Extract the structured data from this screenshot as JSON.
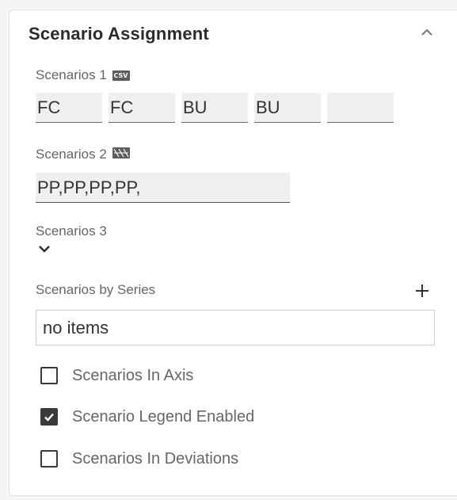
{
  "panel": {
    "title": "Scenario Assignment"
  },
  "scenarios1": {
    "label": "Scenarios 1",
    "badge": "CSV",
    "cells": [
      "FC",
      "FC",
      "BU",
      "BU",
      ""
    ]
  },
  "scenarios2": {
    "label": "Scenarios 2",
    "value": "PP,PP,PP,PP,"
  },
  "scenarios3": {
    "label": "Scenarios 3"
  },
  "scenarios_by_series": {
    "label": "Scenarios by Series",
    "list_text": "no items"
  },
  "options": [
    {
      "label": "Scenarios In Axis",
      "checked": false
    },
    {
      "label": "Scenario Legend Enabled",
      "checked": true
    },
    {
      "label": "Scenarios In Deviations",
      "checked": false
    }
  ],
  "icons": {
    "collapse": "chevron-up-icon",
    "expand": "chevron-down-icon",
    "add": "plus-icon",
    "csv": "csv-icon",
    "check": "checkmark-icon"
  }
}
